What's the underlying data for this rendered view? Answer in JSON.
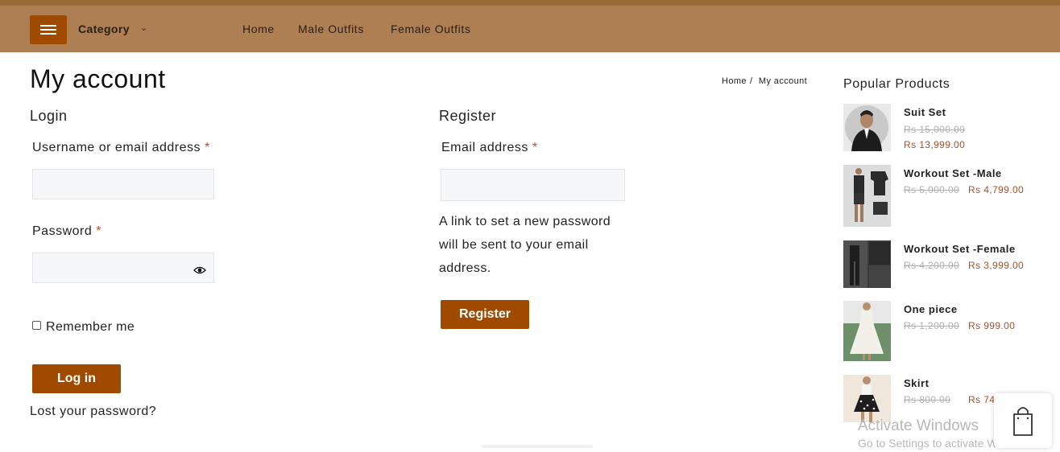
{
  "header": {
    "category_label": "Category",
    "nav": [
      "Home",
      "Male Outfits",
      "Female Outfits"
    ]
  },
  "page": {
    "title": "My account",
    "breadcrumb": [
      "Home",
      "My account"
    ],
    "breadcrumb_sep": "/"
  },
  "login": {
    "title": "Login",
    "username_label": "Username or email address",
    "password_label": "Password",
    "required_mark": "*",
    "remember_label": "Remember me",
    "button": "Log in",
    "lost_password": "Lost your password?"
  },
  "register": {
    "title": "Register",
    "email_label": "Email address",
    "note": "A link to set a new password will be sent to your email address.",
    "button": "Register"
  },
  "sidebar": {
    "title": "Popular Products",
    "products": [
      {
        "name": "Suit Set",
        "old_price": "Rs 15,000.00",
        "new_price": "Rs 13,999.00"
      },
      {
        "name": "Workout Set -Male",
        "old_price": "Rs 5,000.00",
        "new_price": "Rs 4,799.00"
      },
      {
        "name": "Workout Set -Female",
        "old_price": "Rs 4,200.00",
        "new_price": "Rs 3,999.00"
      },
      {
        "name": "One piece",
        "old_price": "Rs 1,200.00",
        "new_price": "Rs 999.00"
      },
      {
        "name": "Skirt",
        "old_price": "Rs 800.00",
        "new_price": "Rs 749.("
      }
    ]
  },
  "watermark": {
    "line1": "Activate Windows",
    "line2": "Go to Settings to activate Windows."
  },
  "colors": {
    "header_bg": "#ad7f53",
    "accent": "#a04a00",
    "price": "#a0522d",
    "required": "#e2401c"
  }
}
